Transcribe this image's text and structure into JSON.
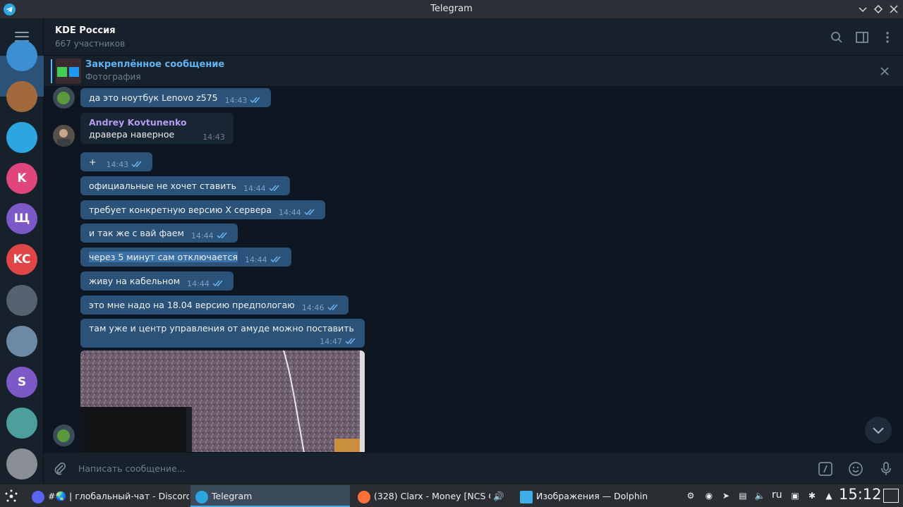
{
  "window": {
    "title": "Telegram"
  },
  "header": {
    "title": "KDE Россия",
    "subtitle": "667 участников"
  },
  "pinned": {
    "title": "Закреплённое сообщение",
    "subtitle": "Фотография"
  },
  "sidebar": {
    "chats": [
      {
        "letter": "",
        "color": "#3c8fd0"
      },
      {
        "letter": "",
        "color": "#a26a3b"
      },
      {
        "letter": "",
        "color": "#2ca5e0"
      },
      {
        "letter": "K",
        "color": "#e0457b"
      },
      {
        "letter": "Щ",
        "color": "#7d58c7"
      },
      {
        "letter": "KC",
        "color": "#e04646"
      },
      {
        "letter": "",
        "color": "#556270"
      },
      {
        "letter": "",
        "color": "#6d8aa5"
      },
      {
        "letter": "S",
        "color": "#7d58c7"
      },
      {
        "letter": "",
        "color": "#4c9f9a"
      },
      {
        "letter": "",
        "color": "#8a8f95"
      }
    ]
  },
  "messages": [
    {
      "text": "да это ноутбук Lenovo z575",
      "time": "14:43"
    },
    {
      "sender": "Andrey Kovtunenko",
      "text": "дравера наверное",
      "time": "14:43"
    },
    {
      "text": "+",
      "time": "14:43"
    },
    {
      "text": "официальные не хочет ставить",
      "time": "14:44"
    },
    {
      "text": "требует конкретную версию X сервера",
      "time": "14:44"
    },
    {
      "text": "и так же с вай фаем",
      "time": "14:44"
    },
    {
      "text": "через 5 минут сам отключается",
      "time": "14:44"
    },
    {
      "text": "живу на кабельном",
      "time": "14:44"
    },
    {
      "text": "это мне надо на 18.04 версию предпологаю",
      "time": "14:46"
    },
    {
      "text": "там уже и центр управления от амуде можно поставить",
      "time": "14:47"
    }
  ],
  "composer": {
    "placeholder": "Написать сообщение..."
  },
  "taskbar": {
    "tasks": [
      {
        "label": "#🌏 | глобальный-чат - Discord"
      },
      {
        "label": "Telegram"
      },
      {
        "label": "(328) Clarx - Money [NCS O..."
      },
      {
        "label": "Изображения — Dolphin"
      }
    ],
    "lang": "ru",
    "clock": "15:12"
  }
}
